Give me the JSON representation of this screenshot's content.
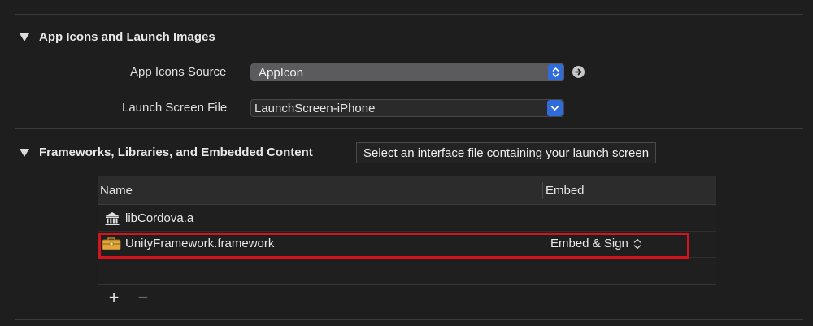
{
  "sections": {
    "app_icons": {
      "title": "App Icons and Launch Images",
      "app_icons_source_label": "App Icons Source",
      "app_icons_source_value": "AppIcon",
      "launch_screen_label": "Launch Screen File",
      "launch_screen_value": "LaunchScreen-iPhone"
    },
    "frameworks": {
      "title": "Frameworks, Libraries, and Embedded Content"
    }
  },
  "tooltip": "Select an interface file containing your launch screen",
  "table": {
    "columns": [
      "Name",
      "Embed"
    ],
    "rows": [
      {
        "name": "libCordova.a",
        "embed": "",
        "icon": "library-icon"
      },
      {
        "name": "UnityFramework.framework",
        "embed": "Embed & Sign",
        "icon": "framework-toolbox-icon"
      }
    ]
  },
  "toolbar": {
    "add_label": "+",
    "remove_label": "−"
  },
  "colors": {
    "accent_blue": "#2f6bd9",
    "highlight_red": "#d4141c",
    "background": "#1e1e1e"
  }
}
